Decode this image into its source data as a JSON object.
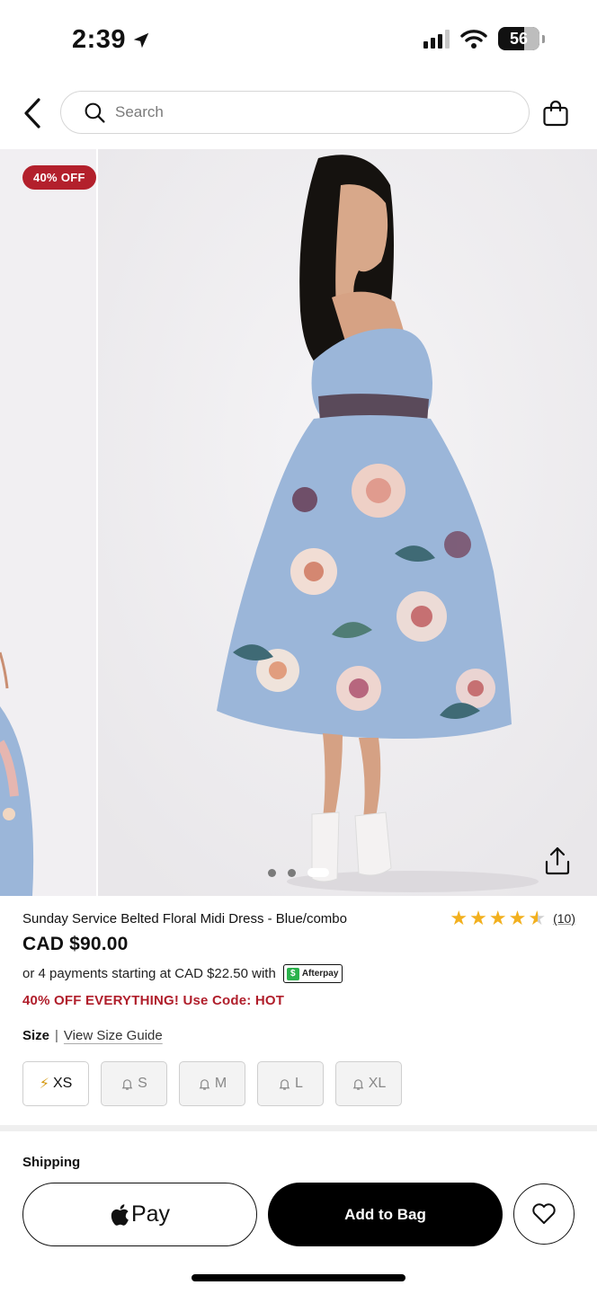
{
  "status_bar": {
    "time": "2:39",
    "battery": "56"
  },
  "header": {
    "search_placeholder": "Search"
  },
  "gallery": {
    "badge": "40% OFF",
    "slide_count": 3,
    "active_slide": 3
  },
  "product": {
    "title": "Sunday Service Belted Floral Midi Dress - Blue/combo",
    "rating": 4.5,
    "review_count": "(10)",
    "price": "CAD $90.00",
    "installments_text": "or 4 payments starting at CAD $22.50 with",
    "afterpay_label": "Afterpay",
    "promo": "40% OFF EVERYTHING! Use Code: HOT"
  },
  "size": {
    "label": "Size",
    "separator": "|",
    "guide_label": "View Size Guide",
    "options": [
      {
        "label": "XS",
        "available": true
      },
      {
        "label": "S",
        "available": false
      },
      {
        "label": "M",
        "available": false
      },
      {
        "label": "L",
        "available": false
      },
      {
        "label": "XL",
        "available": false
      }
    ]
  },
  "shipping": {
    "label": "Shipping"
  },
  "actions": {
    "apple_pay_label": "Pay",
    "add_to_bag_label": "Add to Bag"
  },
  "colors": {
    "promo_red": "#b01e2b",
    "badge_red": "#b3202c",
    "star_gold": "#f2b01e",
    "afterpay_green": "#2bb24c",
    "dress_blue": "#9bb6d9"
  },
  "icons": [
    "location-arrow-icon",
    "signal-icon",
    "wifi-icon",
    "battery-icon",
    "back-chevron-icon",
    "search-icon",
    "shopping-bag-icon",
    "share-icon",
    "star-icon",
    "lightning-icon",
    "bell-icon",
    "apple-icon",
    "heart-icon"
  ]
}
